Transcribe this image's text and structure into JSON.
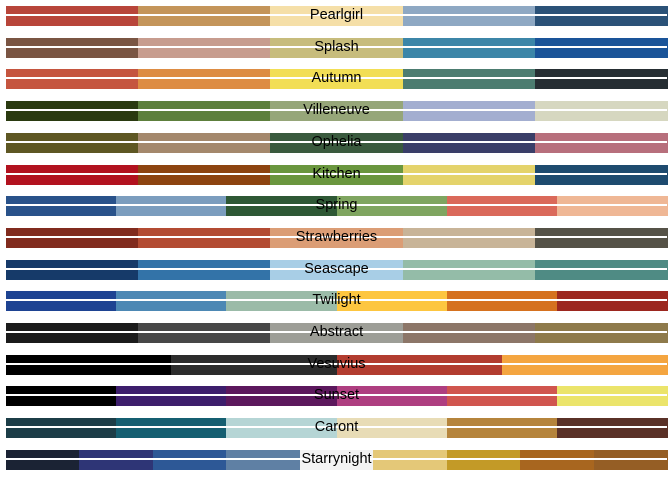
{
  "palettes": [
    {
      "name": "Pearlgirl",
      "colors": [
        "#B8453A",
        "#C4955A",
        "#F5DFA8",
        "#8EA8C3",
        "#2B5278"
      ]
    },
    {
      "name": "Splash",
      "colors": [
        "#7A5543",
        "#C79C8E",
        "#C7BC7C",
        "#3C86A8",
        "#1A5499"
      ]
    },
    {
      "name": "Autumn",
      "colors": [
        "#C5553F",
        "#DD8C43",
        "#F2DE55",
        "#4C7C70",
        "#262E33"
      ]
    },
    {
      "name": "Villeneuve",
      "colors": [
        "#2A3A10",
        "#5D7F3C",
        "#96A679",
        "#A3AED0",
        "#D6D7C0"
      ]
    },
    {
      "name": "Ophelia",
      "colors": [
        "#5E5723",
        "#A4886C",
        "#3A5A3E",
        "#3A3E68",
        "#B76F7C"
      ]
    },
    {
      "name": "Kitchen",
      "colors": [
        "#B2121F",
        "#8D4410",
        "#6A963E",
        "#E4D36B",
        "#1E4B6F"
      ]
    },
    {
      "name": "Spring",
      "colors": [
        "#29528A",
        "#7B9DBE",
        "#2E5835",
        "#7FA560",
        "#DA695A",
        "#EFB795"
      ]
    },
    {
      "name": "Strawberries",
      "colors": [
        "#812B1E",
        "#B34B32",
        "#DB9D75",
        "#C8B498",
        "#555247"
      ]
    },
    {
      "name": "Seascape",
      "colors": [
        "#163A69",
        "#3373A8",
        "#A8CEE6",
        "#94BCA8",
        "#4F8B84"
      ]
    },
    {
      "name": "Twilight",
      "colors": [
        "#1E4392",
        "#4D88B4",
        "#9BBBA8",
        "#FDC640",
        "#D5711F",
        "#9C271F"
      ]
    },
    {
      "name": "Abstract",
      "colors": [
        "#1B1B1B",
        "#474747",
        "#9D9E97",
        "#8C7668",
        "#8E7A4B"
      ]
    },
    {
      "name": "Vesuvius",
      "colors": [
        "#000000",
        "#2C2C2C",
        "#B23C2F",
        "#F4A540"
      ]
    },
    {
      "name": "Sunset",
      "colors": [
        "#000000",
        "#3D1E6C",
        "#5C185D",
        "#AE3E80",
        "#D0554E",
        "#EBE46B"
      ]
    },
    {
      "name": "Caront",
      "colors": [
        "#1C3D47",
        "#155F71",
        "#B5D5D5",
        "#E8DCB6",
        "#B5843C",
        "#5A3127"
      ]
    },
    {
      "name": "Starrynight",
      "colors": [
        "#1B2334",
        "#2E3576",
        "#2D5896",
        "#5F80A4",
        "#F3F3F3",
        "#E4C878",
        "#C39A27",
        "#A8661F",
        "#955E25"
      ]
    }
  ]
}
